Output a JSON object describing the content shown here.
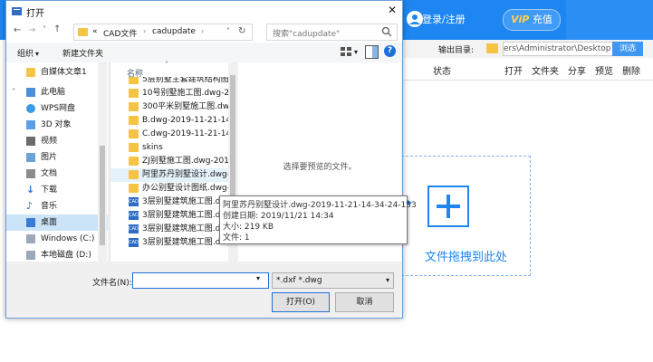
{
  "background_app": {
    "login_label": "登录/注册",
    "vip_label": "充值",
    "vip_badge": "ViP",
    "output_dir_label": "输出目录:",
    "output_dir_value": "ers\\Administrator\\Desktop",
    "browse_label": "浏选",
    "columns": [
      "状态",
      "打开",
      "文件夹",
      "分享",
      "预览",
      "删除"
    ],
    "drop_text": "文件拖拽到此处"
  },
  "dialog": {
    "title": "打开",
    "breadcrumb": [
      "CAD文件",
      "cadupdate"
    ],
    "breadcrumb_prefix": "«",
    "search_placeholder": "搜索\"cadupdate\"",
    "organize_label": "组织",
    "new_folder_label": "新建文件夹",
    "name_column": "名称",
    "nav_items": [
      {
        "label": "自媒体文章1",
        "icon": "folder"
      },
      {
        "label": "此电脑",
        "icon": "pc"
      },
      {
        "label": "WPS网盘",
        "icon": "cloud"
      },
      {
        "label": "3D 对象",
        "icon": "cube"
      },
      {
        "label": "视频",
        "icon": "video"
      },
      {
        "label": "图片",
        "icon": "image"
      },
      {
        "label": "文档",
        "icon": "document"
      },
      {
        "label": "下载",
        "icon": "download"
      },
      {
        "label": "音乐",
        "icon": "music"
      },
      {
        "label": "桌面",
        "icon": "desktop"
      },
      {
        "label": "Windows (C:)",
        "icon": "drive"
      },
      {
        "label": "本地磁盘 (D:)",
        "icon": "drive"
      }
    ],
    "files": [
      {
        "label": "5层别墅主套建筑结构图.dwg",
        "icon": "folder"
      },
      {
        "label": "10号别墅施工图.dwg-2",
        "icon": "folder"
      },
      {
        "label": "300平米别墅施工图.dw",
        "icon": "folder"
      },
      {
        "label": "B.dwg-2019-11-21-14-34-",
        "icon": "folder"
      },
      {
        "label": "C.dwg-2019-11-21-14-34-",
        "icon": "folder"
      },
      {
        "label": "skins",
        "icon": "folder"
      },
      {
        "label": "ZJ别墅施工图.dwg-2019-",
        "icon": "folder"
      },
      {
        "label": "阿里苏丹别墅设计.dwg-2019",
        "icon": "folder"
      },
      {
        "label": "办公别墅设计图纸.dwg-2019",
        "icon": "folder"
      },
      {
        "label": "3层别墅建筑施工图.dwg",
        "icon": "cad"
      },
      {
        "label": "3层别墅建筑施工图.dwg",
        "icon": "cad"
      },
      {
        "label": "3层别墅建筑施工图.dwg-2",
        "icon": "cad"
      },
      {
        "label": "3层别墅建筑施工图.dwg",
        "icon": "cad"
      }
    ],
    "cad_icon_text": "CAD",
    "preview_text": "选择要预览的文件。",
    "filename_label": "文件名(N):",
    "filename_value": "",
    "filetype_value": "*.dxf *.dwg",
    "open_label": "打开(O)",
    "cancel_label": "取消"
  },
  "tooltip": {
    "line1": "阿里苏丹别墅设计.dwg-2019-11-21-14-34-24-153",
    "line2": "创建日期: 2019/11/21 14:34",
    "line3": "大小: 219 KB",
    "line4": "文件: 1"
  }
}
